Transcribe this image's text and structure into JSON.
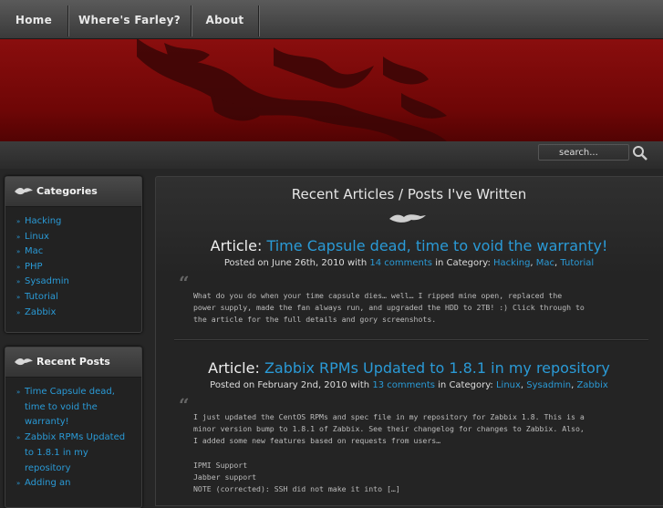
{
  "nav": {
    "items": [
      {
        "label": "Home"
      },
      {
        "label": "Where's Farley?"
      },
      {
        "label": "About"
      }
    ]
  },
  "search": {
    "placeholder": "search..."
  },
  "sidebar": {
    "categories": {
      "title": "Categories",
      "items": [
        "Hacking",
        "Linux",
        "Mac",
        "PHP",
        "Sysadmin",
        "Tutorial",
        "Zabbix"
      ]
    },
    "recent_posts": {
      "title": "Recent Posts",
      "items": [
        "Time Capsule dead, time to void the warranty!",
        "Zabbix RPMs Updated to 1.8.1 in my repository",
        "Adding an"
      ]
    }
  },
  "main": {
    "page_title": "Recent Articles / Posts I've Written",
    "articles": [
      {
        "prefix": "Article:",
        "title": "Time Capsule dead, time to void the warranty!",
        "meta_posted": "Posted on June 26th, 2010 with",
        "comments": "14 comments",
        "meta_in": "in Category:",
        "categories": [
          "Hacking",
          "Mac",
          "Tutorial"
        ],
        "excerpt": "What do you do when your time capsule dies… well… I ripped mine open, replaced the\npower supply, made the fan always run, and upgraded the HDD to 2TB! :) Click through to\nthe article for the full details and gory screenshots."
      },
      {
        "prefix": "Article:",
        "title": "Zabbix RPMs Updated to 1.8.1 in my repository",
        "meta_posted": "Posted on February 2nd, 2010 with",
        "comments": "13 comments",
        "meta_in": "in Category:",
        "categories": [
          "Linux",
          "Sysadmin",
          "Zabbix"
        ],
        "excerpt": "I just updated the CentOS RPMs and spec file in my repository for Zabbix 1.8. This is a\nminor version bump to 1.8.1 of Zabbix. See their changelog for changes to Zabbix. Also,\nI added some new features based on requests from users…\n\nIPMI Support\nJabber support\nNOTE (corrected): SSH did not make it into […]"
      }
    ]
  },
  "colors": {
    "accent": "#2a9ad6",
    "banner": "#7a0a0a",
    "background": "#262626"
  }
}
